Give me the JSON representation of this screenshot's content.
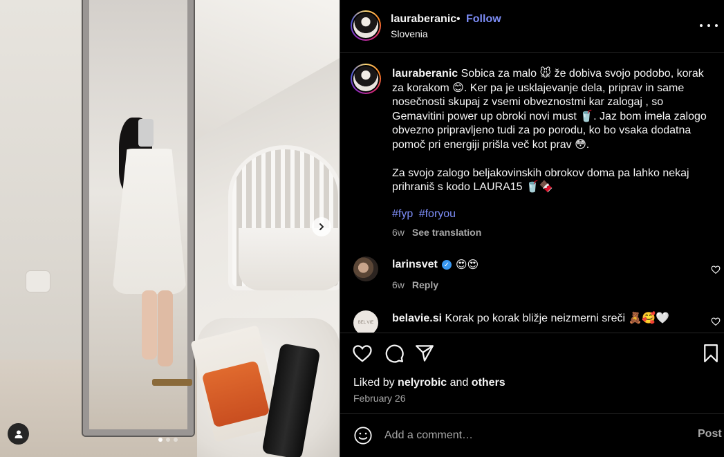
{
  "header": {
    "username": "lauraberanic",
    "separator": "•",
    "follow_label": "Follow",
    "location": "Slovenia",
    "more_icon": "more-horizontal-icon"
  },
  "media": {
    "next_icon": "chevron-right-icon",
    "tag_icon": "user-tag-icon",
    "carousel_count": 3,
    "carousel_active": 1
  },
  "caption": {
    "username": "lauraberanic",
    "paragraph1": "Sobica za malo 🐭 že dobiva svojo podobo, korak za korakom 😊. Ker pa je usklajevanje dela, priprav in same nosečnosti skupaj z vsemi obveznostmi kar zalogaj , so Gemavitini power up obroki novi must 🥤. Jaz bom imela zalogo obvezno pripravljeno tudi za po porodu, ko bo vsaka dodatna pomoč pri energiji prišla več kot prav 😳.",
    "paragraph2": "Za svojo zalogo beljakovinskih obrokov doma pa lahko nekaj prihraniš s kodo LAURA15 🥤🍫",
    "hashtags": [
      "#fyp",
      "#foryou"
    ],
    "age": "6w",
    "see_translation": "See translation"
  },
  "comments": [
    {
      "username": "larinsvet",
      "verified": true,
      "text": "😍😍",
      "age": "6w",
      "reply_label": "Reply"
    },
    {
      "username": "belavie.si",
      "text": "Korak po korak bližje neizmerni sreči 🧸🥰🤍",
      "avatar_text": "BEL VIE"
    }
  ],
  "actions": {
    "like_icon": "heart-icon",
    "comment_icon": "comment-icon",
    "share_icon": "share-icon",
    "save_icon": "bookmark-icon",
    "liked_by_prefix": "Liked by",
    "liked_by_user": "nelyrobic",
    "liked_by_and": "and",
    "liked_by_others": "others",
    "date": "February 26"
  },
  "add_comment": {
    "placeholder": "Add a comment…",
    "post_label": "Post",
    "emoji_icon": "emoji-icon"
  },
  "colors": {
    "background": "#000000",
    "text": "#f5f5f5",
    "secondary": "#a8a8a8",
    "link": "#7c8cf5",
    "divider": "#262626"
  }
}
